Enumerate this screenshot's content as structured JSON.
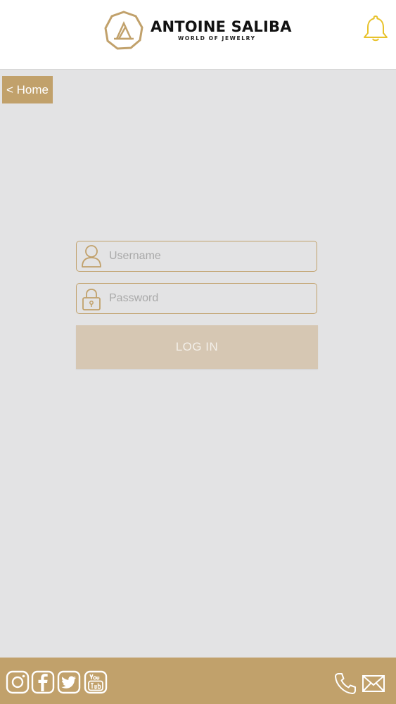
{
  "header": {
    "brand_name": "ANTOINE SALIBA",
    "brand_tagline": "WORLD OF JEWELRY",
    "logo_icon": "brand-logo-icon",
    "notification_icon": "bell-icon"
  },
  "nav": {
    "home_label": "< Home"
  },
  "login_form": {
    "username_placeholder": "Username",
    "username_value": "",
    "username_icon": "user-icon",
    "password_placeholder": "Password",
    "password_value": "",
    "password_icon": "lock-icon",
    "submit_label": "LOG IN"
  },
  "footer": {
    "social_icons": [
      "instagram-icon",
      "facebook-icon",
      "twitter-icon",
      "youtube-icon"
    ],
    "contact_icons": [
      "phone-icon",
      "mail-icon"
    ]
  },
  "colors": {
    "accent": "#c1a16b",
    "background": "#e3e3e4",
    "button_disabled": "#d6c7b3",
    "bell": "#e8c22a"
  }
}
